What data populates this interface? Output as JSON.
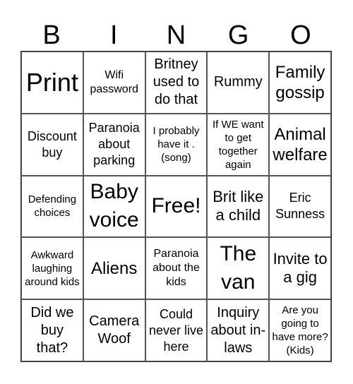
{
  "header": {
    "letters": [
      "B",
      "I",
      "N",
      "G",
      "O"
    ]
  },
  "cells": [
    [
      "Print",
      "Wifi password",
      "Britney used to do that",
      "Rummy",
      "Family gossip"
    ],
    [
      "Discount buy",
      "Paranoia about parking",
      "I probably have it . (song)",
      "If WE want to get together again",
      "Animal welfare"
    ],
    [
      "Defending choices",
      "Baby voice",
      "Free!",
      "Brit like a child",
      "Eric Sunness"
    ],
    [
      "Awkward laughing around kids",
      "Aliens",
      "Paranoia about the kids",
      "The van",
      "Invite to a gig"
    ],
    [
      "Did we buy that?",
      "Camera Woof",
      "Could never live here",
      "Inquiry about in-laws",
      "Are you going to have more? (Kids)"
    ]
  ]
}
